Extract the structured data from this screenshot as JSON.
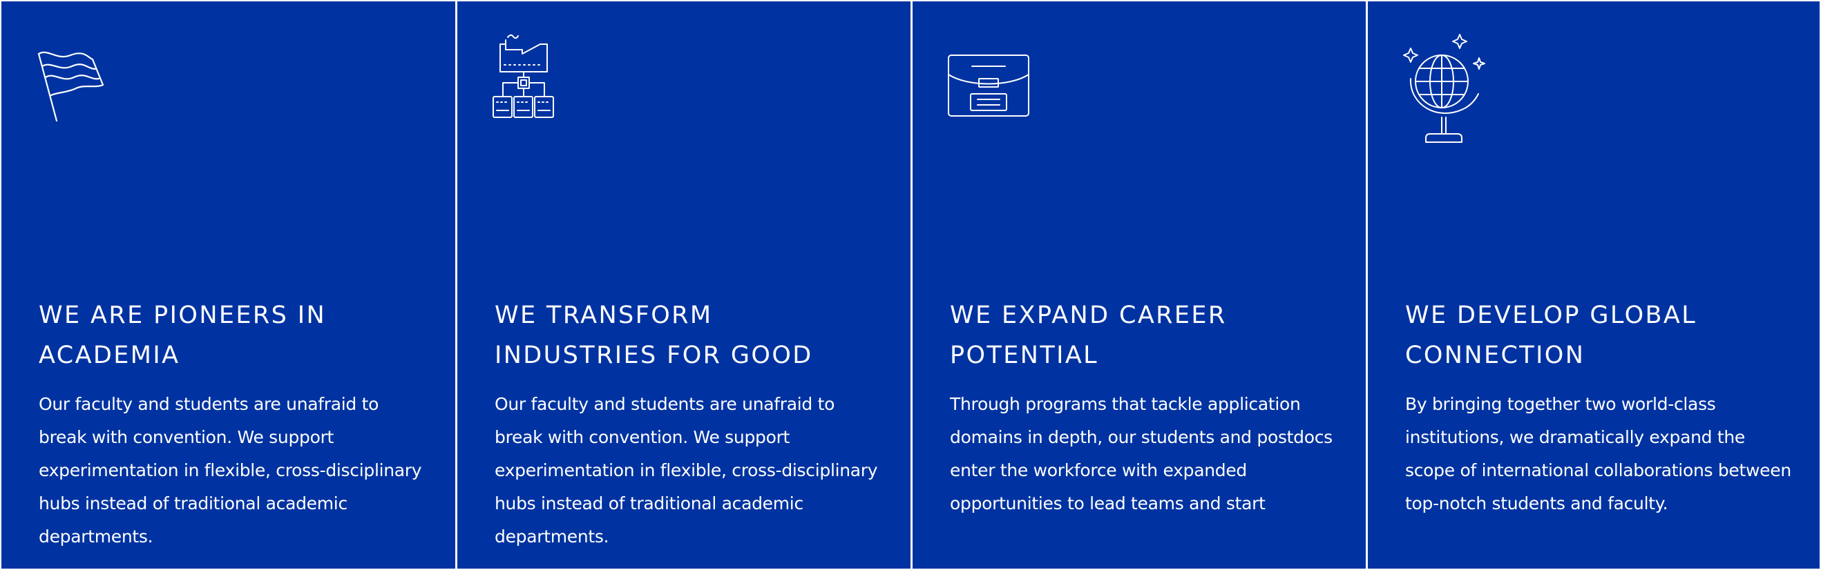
{
  "colors": {
    "card_background": "#0033a1",
    "text": "#ffffff",
    "gutter": "#ffffff"
  },
  "cards": [
    {
      "icon": "flag-icon",
      "title": "WE ARE PIONEERS IN ACADEMIA",
      "body": "Our faculty and students are unafraid to break with convention. We support experimentation in flexible, cross-disciplinary hubs instead of traditional academic departments."
    },
    {
      "icon": "factory-network-icon",
      "title": "WE TRANSFORM INDUSTRIES FOR GOOD",
      "body": "Our faculty and students are unafraid to break with convention. We support experimentation in flexible, cross-disciplinary hubs instead of traditional academic departments."
    },
    {
      "icon": "briefcase-icon",
      "title": "WE EXPAND CAREER POTENTIAL",
      "body": "Through programs that tackle application domains in depth, our students and postdocs enter the workforce with expanded opportunities to lead teams and start"
    },
    {
      "icon": "globe-icon",
      "title": "WE DEVELOP GLOBAL CONNECTION",
      "body": "By bringing together two world-class institutions, we dramatically expand the scope of international collaborations between top-notch students and faculty."
    }
  ]
}
